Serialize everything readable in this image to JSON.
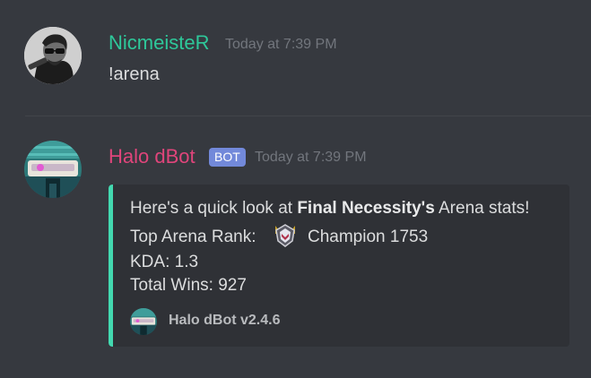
{
  "messages": [
    {
      "author": "NicmeisteR",
      "author_color": "#2ec89a",
      "avatar": "user-photo-icon",
      "timestamp": "Today at 7:39 PM",
      "content": "!arena"
    },
    {
      "author": "Halo dBot",
      "author_color": "#e0457b",
      "avatar": "halo-helmet-icon",
      "bot_tag": "BOT",
      "timestamp": "Today at 7:39 PM",
      "embed": {
        "accent_color": "#43d9b0",
        "intro_prefix": "Here's a quick look at ",
        "player_name": "Final Necessity's",
        "intro_suffix": " Arena stats!",
        "rank_label": "Top Arena Rank:",
        "rank_icon": "champion-rank-icon",
        "rank_value": "Champion 1753",
        "kda": "KDA: 1.3",
        "total_wins": "Total Wins: 927",
        "footer_icon": "halo-helmet-icon",
        "footer_text": "Halo dBot v2.4.6"
      }
    }
  ]
}
